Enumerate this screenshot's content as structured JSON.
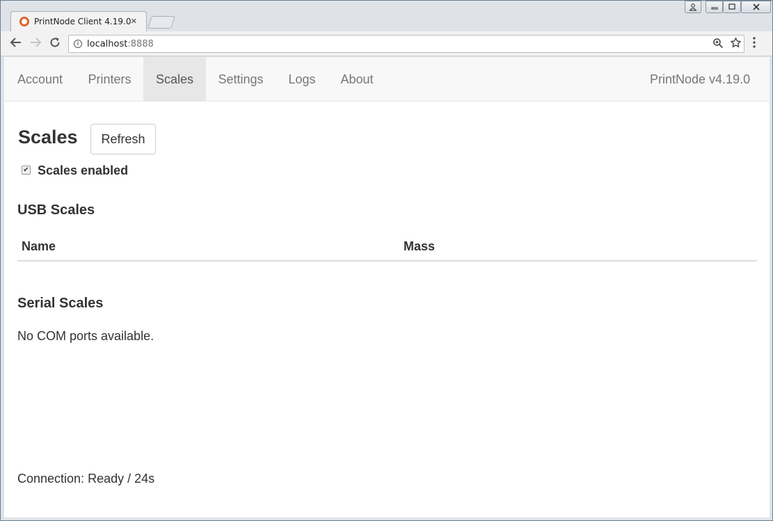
{
  "browser": {
    "tab_title": "PrintNode Client 4.19.0",
    "tab_close": "×",
    "url_host": "localhost",
    "url_port": ":8888"
  },
  "navbar": {
    "items": [
      {
        "label": "Account",
        "active": false
      },
      {
        "label": "Printers",
        "active": false
      },
      {
        "label": "Scales",
        "active": true
      },
      {
        "label": "Settings",
        "active": false
      },
      {
        "label": "Logs",
        "active": false
      },
      {
        "label": "About",
        "active": false
      }
    ],
    "brand": "PrintNode v4.19.0"
  },
  "main": {
    "title": "Scales",
    "refresh_label": "Refresh",
    "scales_enabled_label": "Scales enabled",
    "scales_enabled": true,
    "usb_section_title": "USB Scales",
    "usb_table_headers": [
      "Name",
      "Mass"
    ],
    "usb_rows": [],
    "serial_section_title": "Serial Scales",
    "serial_message": "No COM ports available.",
    "connection_status": "Connection: Ready / 24s"
  },
  "colors": {
    "navbar_bg": "#f8f8f8",
    "navbar_active_bg": "#e7e7e7",
    "text": "#333333",
    "favicon_accent": "#e0622c"
  }
}
